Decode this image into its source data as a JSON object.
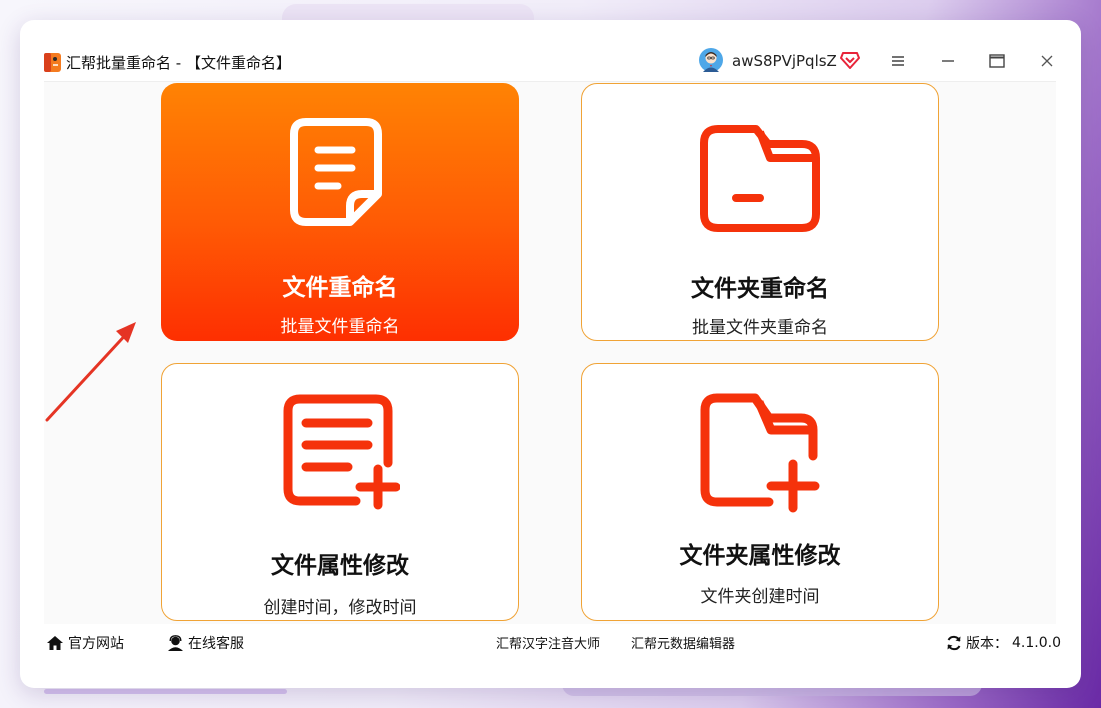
{
  "window": {
    "title": "汇帮批量重命名 - 【文件重命名】",
    "username": "awS8PVjPqlsZ"
  },
  "icons": {
    "app_logo": "app-logo-icon",
    "avatar": "avatar-icon",
    "vip": "vip-diamond-icon",
    "menu": "hamburger-menu-icon",
    "minimize": "minimize-icon",
    "maximize": "maximize-icon",
    "close": "close-icon"
  },
  "colors": {
    "accent_orange": "#ff7a05",
    "accent_red": "#fb2c05",
    "card_border": "#f0a336",
    "annotation_arrow": "#e53424"
  },
  "cards": [
    {
      "title": "文件重命名",
      "subtitle": "批量文件重命名",
      "icon": "document-icon",
      "selected": true
    },
    {
      "title": "文件夹重命名",
      "subtitle": "批量文件夹重命名",
      "icon": "folder-icon",
      "selected": false
    },
    {
      "title": "文件属性修改",
      "subtitle": "创建时间，修改时间",
      "icon": "document-add-icon",
      "selected": false
    },
    {
      "title": "文件夹属性修改",
      "subtitle": "文件夹创建时间",
      "icon": "folder-add-icon",
      "selected": false
    }
  ],
  "footer": {
    "official_site": "官方网站",
    "online_service": "在线客服",
    "pinyin_tool": "汇帮汉字注音大师",
    "metadata_tool": "汇帮元数据编辑器",
    "version_label": "版本：",
    "version": "4.1.0.0"
  }
}
